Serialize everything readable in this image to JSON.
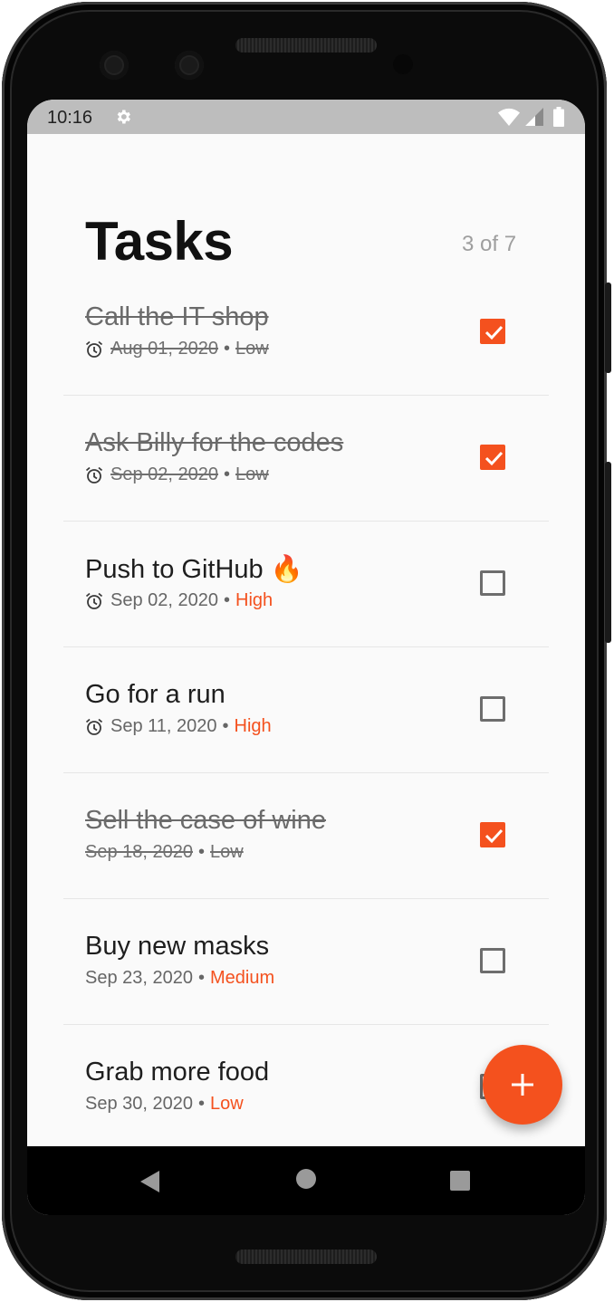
{
  "status_bar": {
    "time": "10:16"
  },
  "header": {
    "title": "Tasks",
    "count": "3 of 7"
  },
  "tasks": [
    {
      "name": "Call the IT shop",
      "date": "Aug 01, 2020",
      "priority": "Low",
      "completed": true,
      "reminder": true
    },
    {
      "name": "Ask Billy for the codes",
      "date": "Sep 02, 2020",
      "priority": "Low",
      "completed": true,
      "reminder": true
    },
    {
      "name": "Push to GitHub 🔥",
      "date": "Sep 02, 2020",
      "priority": "High",
      "completed": false,
      "reminder": true
    },
    {
      "name": "Go for a run",
      "date": "Sep 11, 2020",
      "priority": "High",
      "completed": false,
      "reminder": true
    },
    {
      "name": "Sell the case of wine",
      "date": "Sep 18, 2020",
      "priority": "Low",
      "completed": true,
      "reminder": false
    },
    {
      "name": "Buy new masks",
      "date": "Sep 23, 2020",
      "priority": "Medium",
      "completed": false,
      "reminder": false
    },
    {
      "name": "Grab more food",
      "date": "Sep 30, 2020",
      "priority": "Low",
      "completed": false,
      "reminder": false
    }
  ],
  "fab": {
    "icon": "plus-icon"
  },
  "colors": {
    "accent": "#f4511e",
    "status_bar": "#bdbdbd",
    "background": "#fafafa"
  }
}
